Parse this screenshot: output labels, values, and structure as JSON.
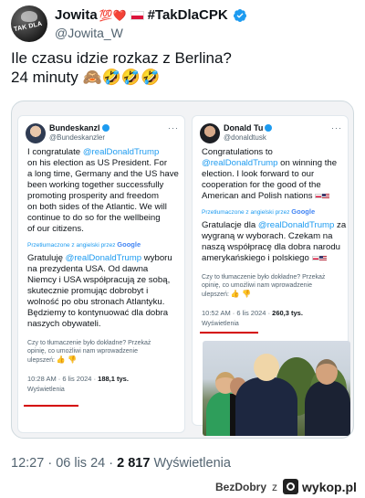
{
  "author": {
    "name": "Jowita",
    "name_emojis": "💯❤️",
    "hashtag": "#TakDlaCPK",
    "handle": "@Jowita_W",
    "avatar_text": "TAK DLA"
  },
  "tweet": {
    "line1": "Ile czasu idzie rozkaz z Berlina?",
    "line2": "24 minuty",
    "line2_emojis": "🙈🤣🤣🤣"
  },
  "left_post": {
    "name": "Bundeskanzl",
    "handle": "@Bundeskanzler",
    "dots": "···",
    "body_lines": [
      "I congratulate ",
      "on his election as US President. For",
      "a long time, Germany and the US have",
      "been working together successfully",
      "promoting prosperity and freedom",
      "on both sides of the Atlantic. We will",
      "continue to do so for the wellbeing",
      "of our citizens."
    ],
    "mention": "@realDonaldTrump",
    "translated_label": "Przetłumaczone z angielski przez",
    "translator": "Google",
    "pl_lines": [
      "Gratuluję ",
      " wyboru",
      "na prezydenta USA. Od dawna",
      "Niemcy i USA współpracują ze sobą,",
      "skutecznie promując dobrobyt i",
      "wolność po obu stronach Atlantyku.",
      "Będziemy to kontynuować dla dobra",
      "naszych obywateli."
    ],
    "feedback_lines": [
      "Czy to tłumaczenie było dokładne? Przekaż",
      "opinię, co umożliwi nam wprowadzenie",
      "ulepszeń:"
    ],
    "thumbs": "👍 👎",
    "time": "10:28 AM",
    "date": "6 lis 2024",
    "views": "188,1 tys.",
    "views_label": "Wyświetlenia"
  },
  "right_post": {
    "name": "Donald Tu",
    "handle": "@donaldtusk",
    "dots": "···",
    "body_lines": [
      "Congratulations to",
      " on winning the",
      "election. I look forward to our",
      "cooperation for the good of the",
      "American and Polish nations"
    ],
    "mention": "@realDonaldTrump",
    "translated_label": "Przetłumaczone z angielski przez",
    "translator": "Google",
    "pl_lines": [
      "Gratulacje dla ",
      " za",
      "wygraną w wyborach. Czekam na",
      "naszą współpracę dla dobra narodu",
      "amerykańskiego i polskiego"
    ],
    "feedback_lines": [
      "Czy to tłumaczenie było dokładne? Przekaż",
      "opinię, co umożliwi nam wprowadzenie",
      "ulepszeń:"
    ],
    "thumbs": "👍 👎",
    "time": "10:52 AM",
    "date": "6 lis 2024",
    "views": "260,3 tys.",
    "views_label": "Wyświetlenia"
  },
  "footer": {
    "time": "12:27",
    "sep": "·",
    "date": "06 lis 24",
    "views_count": "2 817",
    "views_label": "Wyświetlenia"
  },
  "watermark": {
    "user": "BezDobry",
    "z": "z",
    "site": "wykop.pl"
  },
  "colors": {
    "accent": "#1d9bf0",
    "underline": "#d40000",
    "muted": "#536471"
  }
}
